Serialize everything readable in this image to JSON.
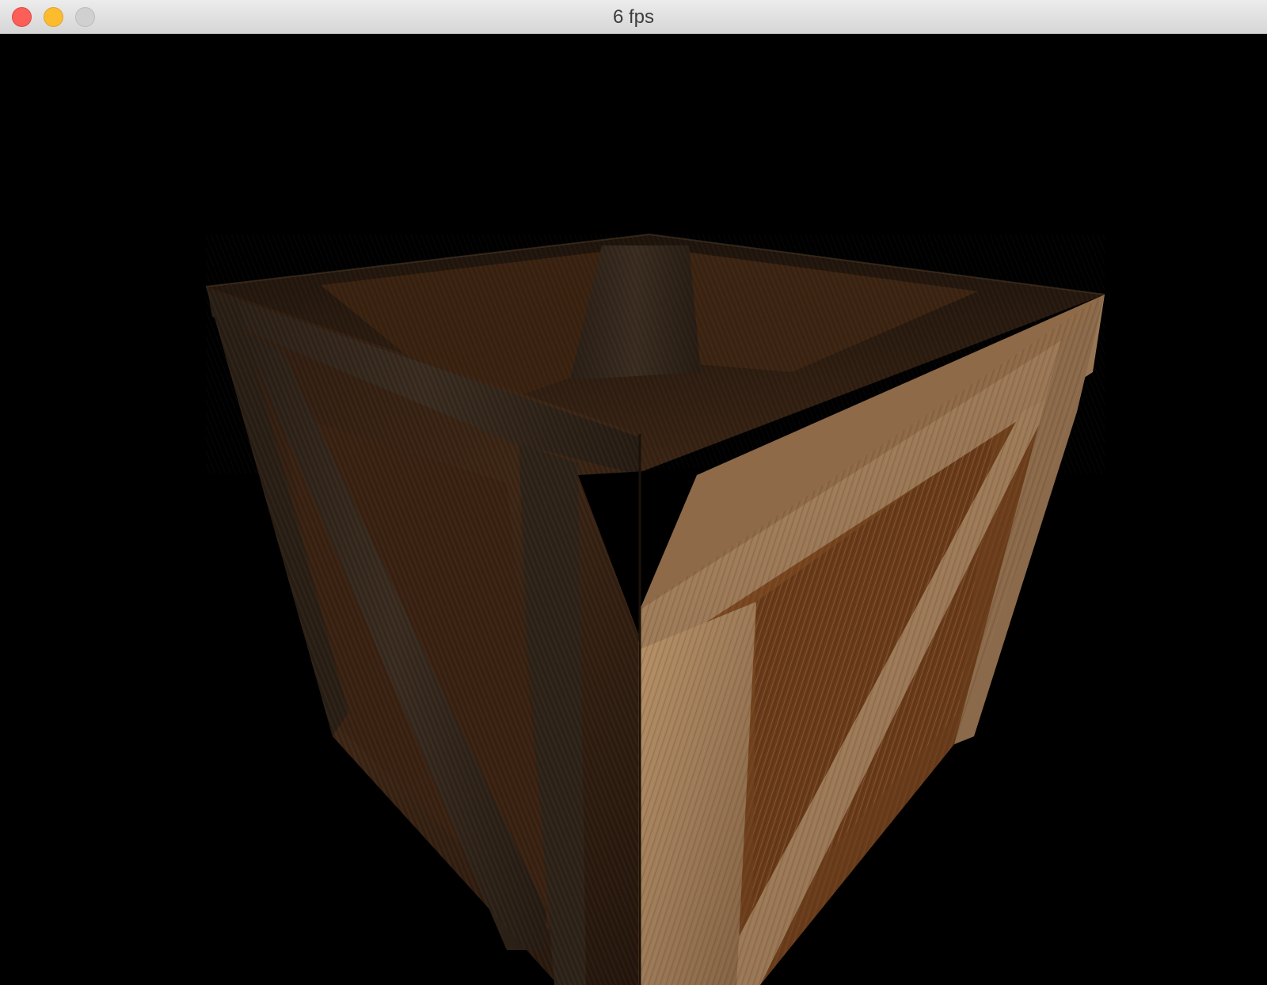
{
  "window": {
    "title": "6 fps",
    "buttons": [
      "close",
      "minimize",
      "zoom"
    ]
  },
  "scene": {
    "background_color": "#000000",
    "object": "wooden-crate",
    "wood_colors": {
      "dark_face": "#3a2818",
      "dark_plank": "#2c2015",
      "lit_plank": "#9a7550",
      "lit_panel": "#7a4a24",
      "top_panel": "#2a1a10"
    }
  }
}
